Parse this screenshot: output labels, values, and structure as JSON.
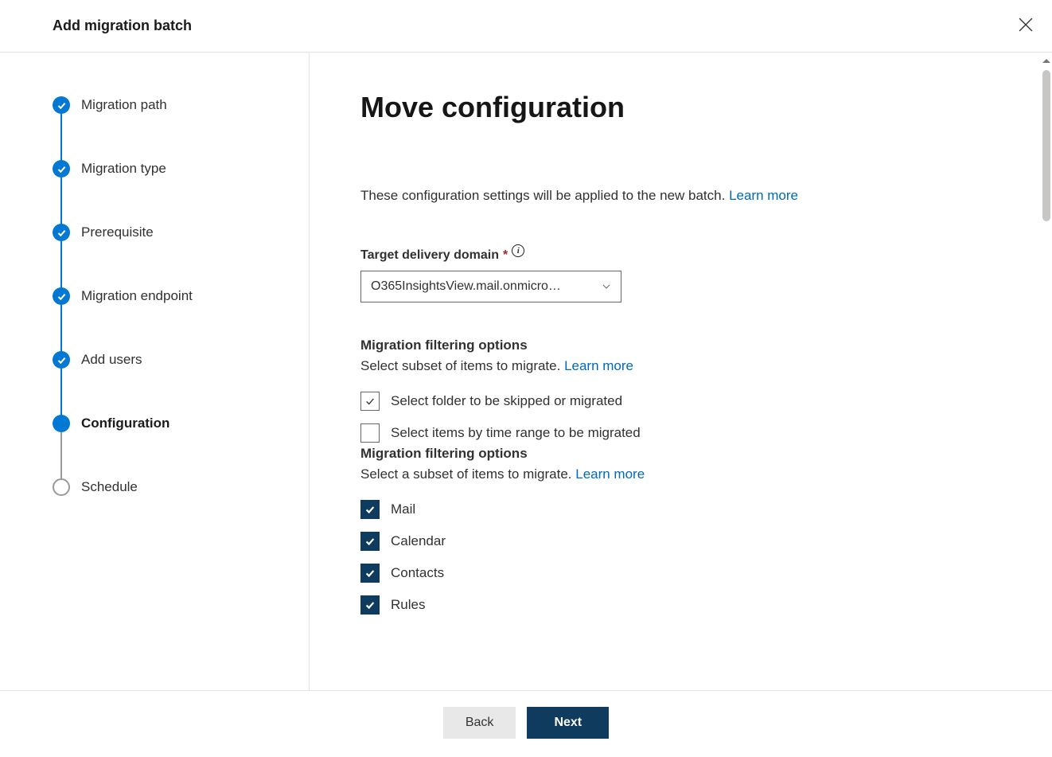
{
  "header": {
    "title": "Add migration batch"
  },
  "steps": [
    {
      "label": "Migration path",
      "state": "done"
    },
    {
      "label": "Migration type",
      "state": "done"
    },
    {
      "label": "Prerequisite",
      "state": "done"
    },
    {
      "label": "Migration endpoint",
      "state": "done"
    },
    {
      "label": "Add users",
      "state": "done"
    },
    {
      "label": "Configuration",
      "state": "current"
    },
    {
      "label": "Schedule",
      "state": "future"
    }
  ],
  "main": {
    "title": "Move configuration",
    "intro_text": "These configuration settings will be applied to the new batch. ",
    "intro_link": "Learn more",
    "target_domain": {
      "label": "Target delivery domain",
      "value": "O365InsightsView.mail.onmicro…"
    },
    "filter1": {
      "heading": "Migration filtering options",
      "subtext": "Select subset of items to migrate. ",
      "link": "Learn more",
      "opt_folder": "Select folder to be skipped or migrated",
      "opt_time": "Select items by time range to be migrated"
    },
    "filter2": {
      "heading": "Migration filtering options",
      "subtext": "Select a subset of items to migrate. ",
      "link": "Learn more",
      "items": [
        {
          "label": "Mail",
          "checked": true
        },
        {
          "label": "Calendar",
          "checked": true
        },
        {
          "label": "Contacts",
          "checked": true
        },
        {
          "label": "Rules",
          "checked": true
        }
      ]
    }
  },
  "footer": {
    "back": "Back",
    "next": "Next"
  }
}
